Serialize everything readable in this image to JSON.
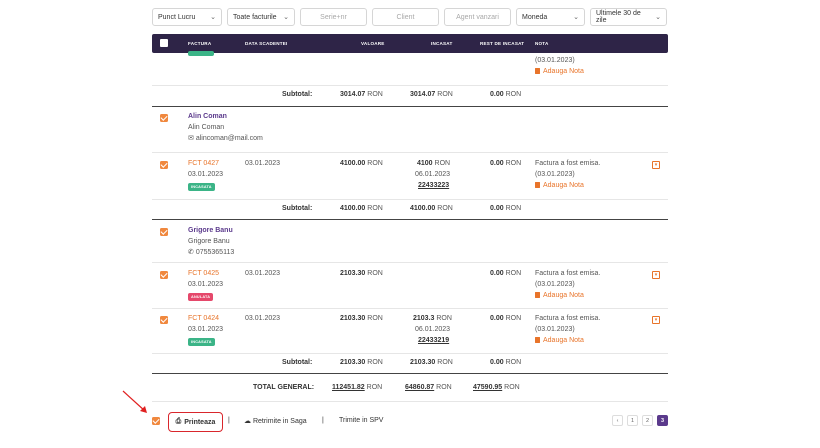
{
  "filters": {
    "punct_lucru": "Punct Lucru",
    "tip_facturi": "Toate facturile",
    "serie_placeholder": "Serie+nr",
    "client_placeholder": "Client",
    "agent_placeholder": "Agent vanzari",
    "moneda": "Moneda",
    "perioada": "Ultimele 30 de zile"
  },
  "table_header": {
    "factura": "FACTURA",
    "data_scadenta": "DATA SCADENTEI",
    "valoare": "VALOARE",
    "incasat": "INCASAT",
    "rest": "REST DE INCASAT",
    "nota": "NOTA"
  },
  "group0": {
    "note_date": "(03.01.2023)",
    "add_note": "Adauga Nota",
    "subtotal_label": "Subtotal:",
    "subtotal_value": "3014.07",
    "subtotal_incasat": "3014.07",
    "subtotal_rest": "0.00",
    "currency": "RON"
  },
  "group1": {
    "client_name": "Alin Coman",
    "contact_name": "Alin Coman",
    "email": "alincoman@mail.com",
    "invoice": {
      "number": "FCT 0427",
      "date": "03.01.2023",
      "status": "INCASATA",
      "due": "03.01.2023",
      "value": "4100.00",
      "paid": "4100",
      "paid_date": "06.01.2023",
      "paid_doc": "22433223",
      "rest": "0.00",
      "note": "Factura a fost emisa.",
      "note_date": "(03.01.2023)",
      "add_note": "Adauga Nota"
    },
    "subtotal_label": "Subtotal:",
    "subtotal_value": "4100.00",
    "subtotal_incasat": "4100.00",
    "subtotal_rest": "0.00"
  },
  "group2": {
    "client_name": "Grigore Banu",
    "contact_name": "Grigore Banu",
    "phone": "0755365113",
    "invoice1": {
      "number": "FCT 0425",
      "date": "03.01.2023",
      "status": "ANULATA",
      "due": "03.01.2023",
      "value": "2103.30",
      "rest": "0.00",
      "note": "Factura a fost emisa.",
      "note_date": "(03.01.2023)",
      "add_note": "Adauga Nota"
    },
    "invoice2": {
      "number": "FCT 0424",
      "date": "03.01.2023",
      "status": "INCASATA",
      "due": "03.01.2023",
      "value": "2103.30",
      "paid": "2103.3",
      "paid_date": "06.01.2023",
      "paid_doc": "22433219",
      "rest": "0.00",
      "note": "Factura a fost emisa.",
      "note_date": "(03.01.2023)",
      "add_note": "Adauga Nota"
    },
    "subtotal_label": "Subtotal:",
    "subtotal_value": "2103.30",
    "subtotal_incasat": "2103.30",
    "subtotal_rest": "0.00"
  },
  "total": {
    "label": "TOTAL GENERAL:",
    "value": "112451.82",
    "incasat": "64860.87",
    "rest": "47590.95",
    "currency": "RON"
  },
  "bottom": {
    "print": "Printeaza",
    "saga": "Retrimite in Saga",
    "spv": "Trimite in SPV",
    "pages": [
      "‹",
      "1",
      "2",
      "3"
    ]
  },
  "colors": {
    "header_bg": "#2e2447",
    "accent_orange": "#e8742a",
    "checkbox": "#f0883e",
    "active_page": "#5b3a8c",
    "badge_green": "#3bb487",
    "badge_red": "#e5486b",
    "highlight_border": "#d9262c"
  }
}
